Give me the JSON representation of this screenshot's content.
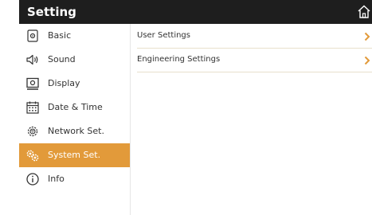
{
  "header": {
    "title": "Setting"
  },
  "sidebar": {
    "items": [
      {
        "label": "Basic",
        "icon": "basic-icon"
      },
      {
        "label": "Sound",
        "icon": "speaker-icon"
      },
      {
        "label": "Display",
        "icon": "display-icon"
      },
      {
        "label": "Date & Time",
        "icon": "calendar-icon"
      },
      {
        "label": "Network Set.",
        "icon": "network-gear-icon"
      },
      {
        "label": "System Set.",
        "icon": "gears-icon",
        "active": true
      },
      {
        "label": "Info",
        "icon": "info-icon"
      }
    ]
  },
  "main": {
    "rows": [
      {
        "label": "User Settings"
      },
      {
        "label": "Engineering Settings"
      }
    ]
  },
  "colors": {
    "header_bg": "#1e1e1e",
    "accent": "#e29a3a",
    "chevron": "#e29a3a"
  }
}
